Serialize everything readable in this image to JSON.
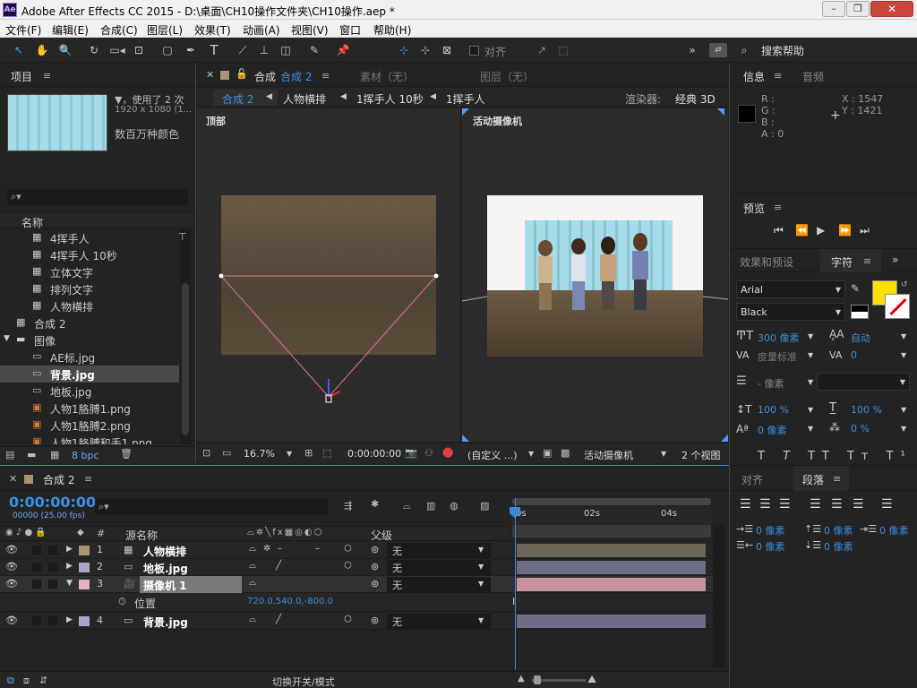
{
  "app": {
    "title": "Adobe After Effects CC 2015 - D:\\桌面\\CH10操作文件夹\\CH10操作.aep *",
    "icon": "Ae"
  },
  "menu": [
    "文件(F)",
    "编辑(E)",
    "合成(C)",
    "图层(L)",
    "效果(T)",
    "动画(A)",
    "视图(V)",
    "窗口",
    "帮助(H)"
  ],
  "toolbar": {
    "align_label": "对齐",
    "search_label": "搜索帮助"
  },
  "project": {
    "title": "项目",
    "info_line1": "▼，使用了 2 次",
    "info_line2": "1920 x 1080 (1...",
    "info_line3": "数百万种颜色",
    "col_name": "名称",
    "bpc": "8 bpc",
    "items": [
      {
        "name": "4挥手人",
        "kind": "comp"
      },
      {
        "name": "4挥手人 10秒",
        "kind": "comp"
      },
      {
        "name": "立体文字",
        "kind": "comp"
      },
      {
        "name": "排列文字",
        "kind": "comp"
      },
      {
        "name": "人物横排",
        "kind": "comp"
      },
      {
        "name": "合成 2",
        "kind": "comp"
      },
      {
        "name": "图像",
        "kind": "folder"
      },
      {
        "name": "AE标.jpg",
        "kind": "image"
      },
      {
        "name": "背景.jpg",
        "kind": "image"
      },
      {
        "name": "地板.jpg",
        "kind": "image"
      },
      {
        "name": "人物1胳膊1.png",
        "kind": "png"
      },
      {
        "name": "人物1胳膊2.png",
        "kind": "png"
      },
      {
        "name": "人物1胳膊和手1.png",
        "kind": "png"
      }
    ]
  },
  "viewer": {
    "tab_comp": "合成",
    "tab_comp_name": "合成 2",
    "tab_footage": "素材（无）",
    "tab_layer": "图层（无）",
    "breadcrumbs": [
      "合成 2",
      "人物横排",
      "1挥手人 10秒",
      "1挥手人"
    ],
    "renderer_label": "渲染器:",
    "renderer_value": "经典 3D",
    "left_view": "顶部",
    "right_view": "活动摄像机",
    "zoom": "16.7%",
    "timecode": "0:00:00:00",
    "resolution": "(自定义 ...)",
    "camera": "活动摄像机",
    "views": "2 个视图"
  },
  "info": {
    "tab": "信息",
    "tab2": "音频",
    "r": "R :",
    "g": "G :",
    "b": "B :",
    "a": "A : 0",
    "x": "X : 1547",
    "y": "Y : 1421"
  },
  "preview": {
    "title": "预览"
  },
  "character": {
    "tab1": "效果和预设",
    "tab2": "字符",
    "font": "Arial",
    "style": "Black",
    "size": "300 像素",
    "leading": "自动",
    "kerning": "度量标准",
    "tracking": "0",
    "stroke": "- 像素",
    "vscale": "100 %",
    "hscale": "100 %",
    "baseline": "0 像素",
    "tsume": "0 %",
    "fill_color": "#FFE000"
  },
  "paragraph": {
    "tab1": "对齐",
    "tab2": "段落",
    "v1": "0 像素",
    "v2": "0 像素",
    "v3": "0 像素",
    "v4": "0 像素",
    "v5": "0 像素"
  },
  "timeline": {
    "tab": "合成 2",
    "timecode": "0:00:00:00",
    "fps": "00000 (25.00 fps)",
    "col_source": "源名称",
    "col_parent": "父级",
    "col_num": "#",
    "marks": [
      "0s",
      "02s",
      "04s"
    ],
    "toggle_label": "切换开关/模式",
    "layers": [
      {
        "num": "1",
        "name": "人物横排",
        "parent": "无",
        "color": "#a89473",
        "bar": "#6e6656"
      },
      {
        "num": "2",
        "name": "地板.jpg",
        "parent": "无",
        "color": "#a8a8c8",
        "bar": "#6d6d86"
      },
      {
        "num": "3",
        "name": "摄像机 1",
        "parent": "无",
        "color": "#e2b0c0",
        "bar": "#c9909f"
      },
      {
        "num": "4",
        "name": "背景.jpg",
        "parent": "无",
        "color": "#a8a8c8",
        "bar": "#6d6d86"
      }
    ],
    "prop_name": "位置",
    "prop_value": "720.0,540.0,-800.0"
  }
}
